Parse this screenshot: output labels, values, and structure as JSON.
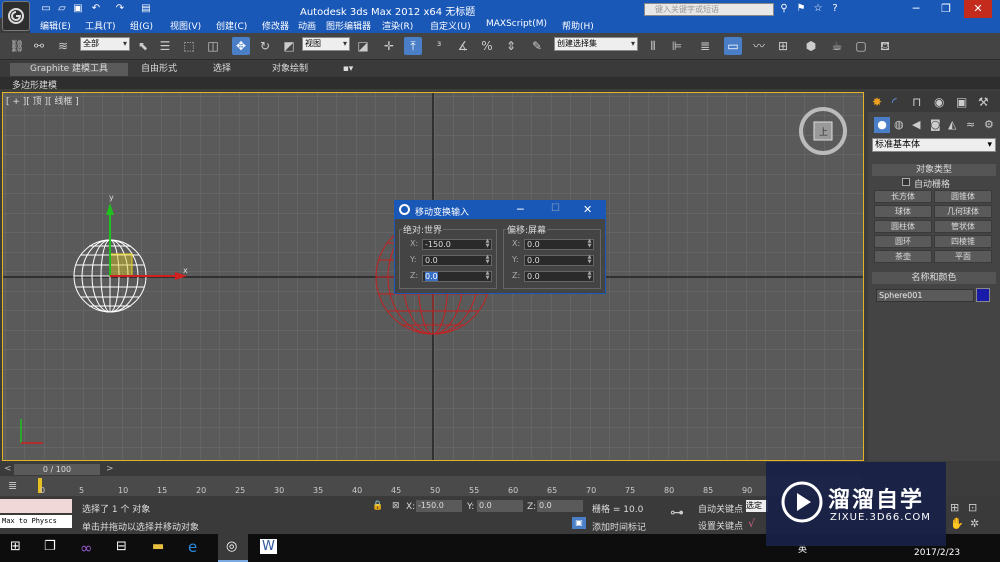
{
  "titlebar": {
    "title": "Autodesk 3ds Max  2012 x64      无标题",
    "search_placeholder": "键入关键字或短语"
  },
  "menu": [
    "编辑(E)",
    "工具(T)",
    "组(G)",
    "视图(V)",
    "创建(C)",
    "修改器",
    "动画",
    "图形编辑器",
    "渲染(R)",
    "自定义(U)",
    "MAXScript(M)",
    "帮助(H)"
  ],
  "toolbar": {
    "selection_filter": "全部",
    "ref_coord": "视图",
    "named_selection": "创建选择集"
  },
  "ribbon": {
    "tabs": [
      "Graphite 建模工具",
      "自由形式",
      "选择",
      "对象绘制"
    ],
    "sub_label": "多边形建模"
  },
  "viewport": {
    "label": "[ + ][ 顶 ][ 线框 ]",
    "axis_x": "x",
    "axis_y": "y",
    "viewcube_label": "上"
  },
  "dialog": {
    "title": "移动变换输入",
    "absolute_group": "绝对:世界",
    "offset_group": "偏移:屏幕",
    "abs_x": "-150.0",
    "abs_y": "0.0",
    "abs_z": "0.0",
    "off_x": "0.0",
    "off_y": "0.0",
    "off_z": "0.0",
    "label_x": "X:",
    "label_y": "Y:",
    "label_z": "Z:"
  },
  "command_panel": {
    "category": "标准基本体",
    "object_type_header": "对象类型",
    "autogrid": "自动栅格",
    "buttons": [
      "长方体",
      "圆锥体",
      "球体",
      "几何球体",
      "圆柱体",
      "管状体",
      "圆环",
      "四棱锥",
      "茶壶",
      "平面"
    ],
    "name_color_header": "名称和颜色",
    "object_name": "Sphere001",
    "object_color": "#1a1aa8"
  },
  "timeline": {
    "frame_label": "0 / 100",
    "ticks": [
      "0",
      "5",
      "10",
      "15",
      "20",
      "25",
      "30",
      "35",
      "40",
      "45",
      "50",
      "55",
      "60",
      "65",
      "70",
      "75",
      "80",
      "85",
      "90"
    ]
  },
  "statusbar": {
    "maxscript_label": "Max to Physcs",
    "selection_status": "选择了 1 个 对象",
    "prompt": "单击并拖动以选择并移动对象",
    "x_value": "-150.0",
    "y_value": "0.0",
    "z_value": "0.0",
    "x_label": "X:",
    "y_label": "Y:",
    "z_label": "Z:",
    "grid": "栅格 = 10.0",
    "auto_key": "自动关键点",
    "set_key": "设置关键点",
    "selected_label": "选定",
    "add_time_tag": "添加时间标记"
  },
  "taskbar": {
    "tray_text": "英",
    "date": "2017/2/23"
  },
  "watermark": {
    "brand": "溜溜自学",
    "url": "ZIXUE.3D66.COM"
  },
  "colors": {
    "title_blue": "#1a58b8",
    "viewport_border": "#e2b22a",
    "sphere_selected": "#ffffff",
    "sphere_ghost": "#cc2020"
  }
}
